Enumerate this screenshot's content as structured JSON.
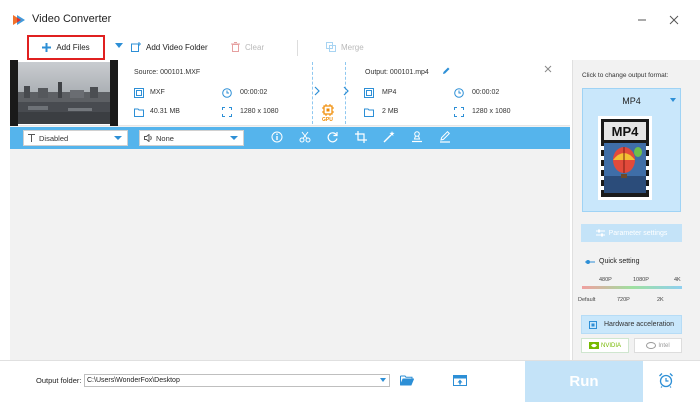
{
  "window": {
    "title": "Video Converter"
  },
  "toolbar": {
    "add_files": "Add Files",
    "add_folder": "Add Video Folder",
    "clear": "Clear",
    "merge": "Merge"
  },
  "file": {
    "source": {
      "name": "Source: 000101.MXF",
      "format": "MXF",
      "duration": "00:00:02",
      "size": "40.31 MB",
      "resolution": "1280 x 1080"
    },
    "output": {
      "name": "Output: 000101.mp4",
      "format": "MP4",
      "duration": "00:00:02",
      "size": "2 MB",
      "resolution": "1280 x 1080"
    },
    "gpu_badge": "GPU"
  },
  "edit_bar": {
    "subtitle_value": "Disabled",
    "audio_value": "None",
    "icons": [
      "info-icon",
      "cut-icon",
      "rotate-icon",
      "crop-icon",
      "effects-icon",
      "watermark-icon",
      "edit-metadata-icon"
    ]
  },
  "right_panel": {
    "hint": "Click to change output format:",
    "format": "MP4",
    "format_icon_text": "MP4",
    "parameter_settings": "Parameter settings",
    "quick_setting": "Quick setting",
    "quality_top": [
      "480P",
      "1080P",
      "4K"
    ],
    "quality_bottom": [
      "Default",
      "720P",
      "2K"
    ],
    "hardware_acceleration": "Hardware acceleration",
    "nvidia": "NVIDIA",
    "intel": "Intel"
  },
  "bottom": {
    "output_folder_label": "Output folder:",
    "output_folder_value": "C:\\Users\\WonderFox\\Desktop",
    "run": "Run"
  },
  "colors": {
    "accent": "#55b4ec",
    "accent_dark": "#2d8fd6",
    "highlight": "#e02020",
    "gpu": "#f08a00"
  }
}
